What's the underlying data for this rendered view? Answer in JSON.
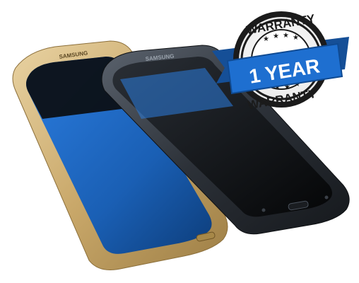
{
  "product": {
    "brand_front": "SAMSUNG",
    "brand_back": "SAMSUNG",
    "gold_color": "#c9a86a",
    "dark_color": "#2c3138",
    "screen_blue": "#1a5fb4"
  },
  "badge": {
    "top_text": "WARRANTY",
    "ribbon_text": "1 YEAR",
    "bottom_text": "WARRANTY",
    "ribbon_color": "#1e6fd0",
    "seal_color": "#1b1b1b"
  }
}
